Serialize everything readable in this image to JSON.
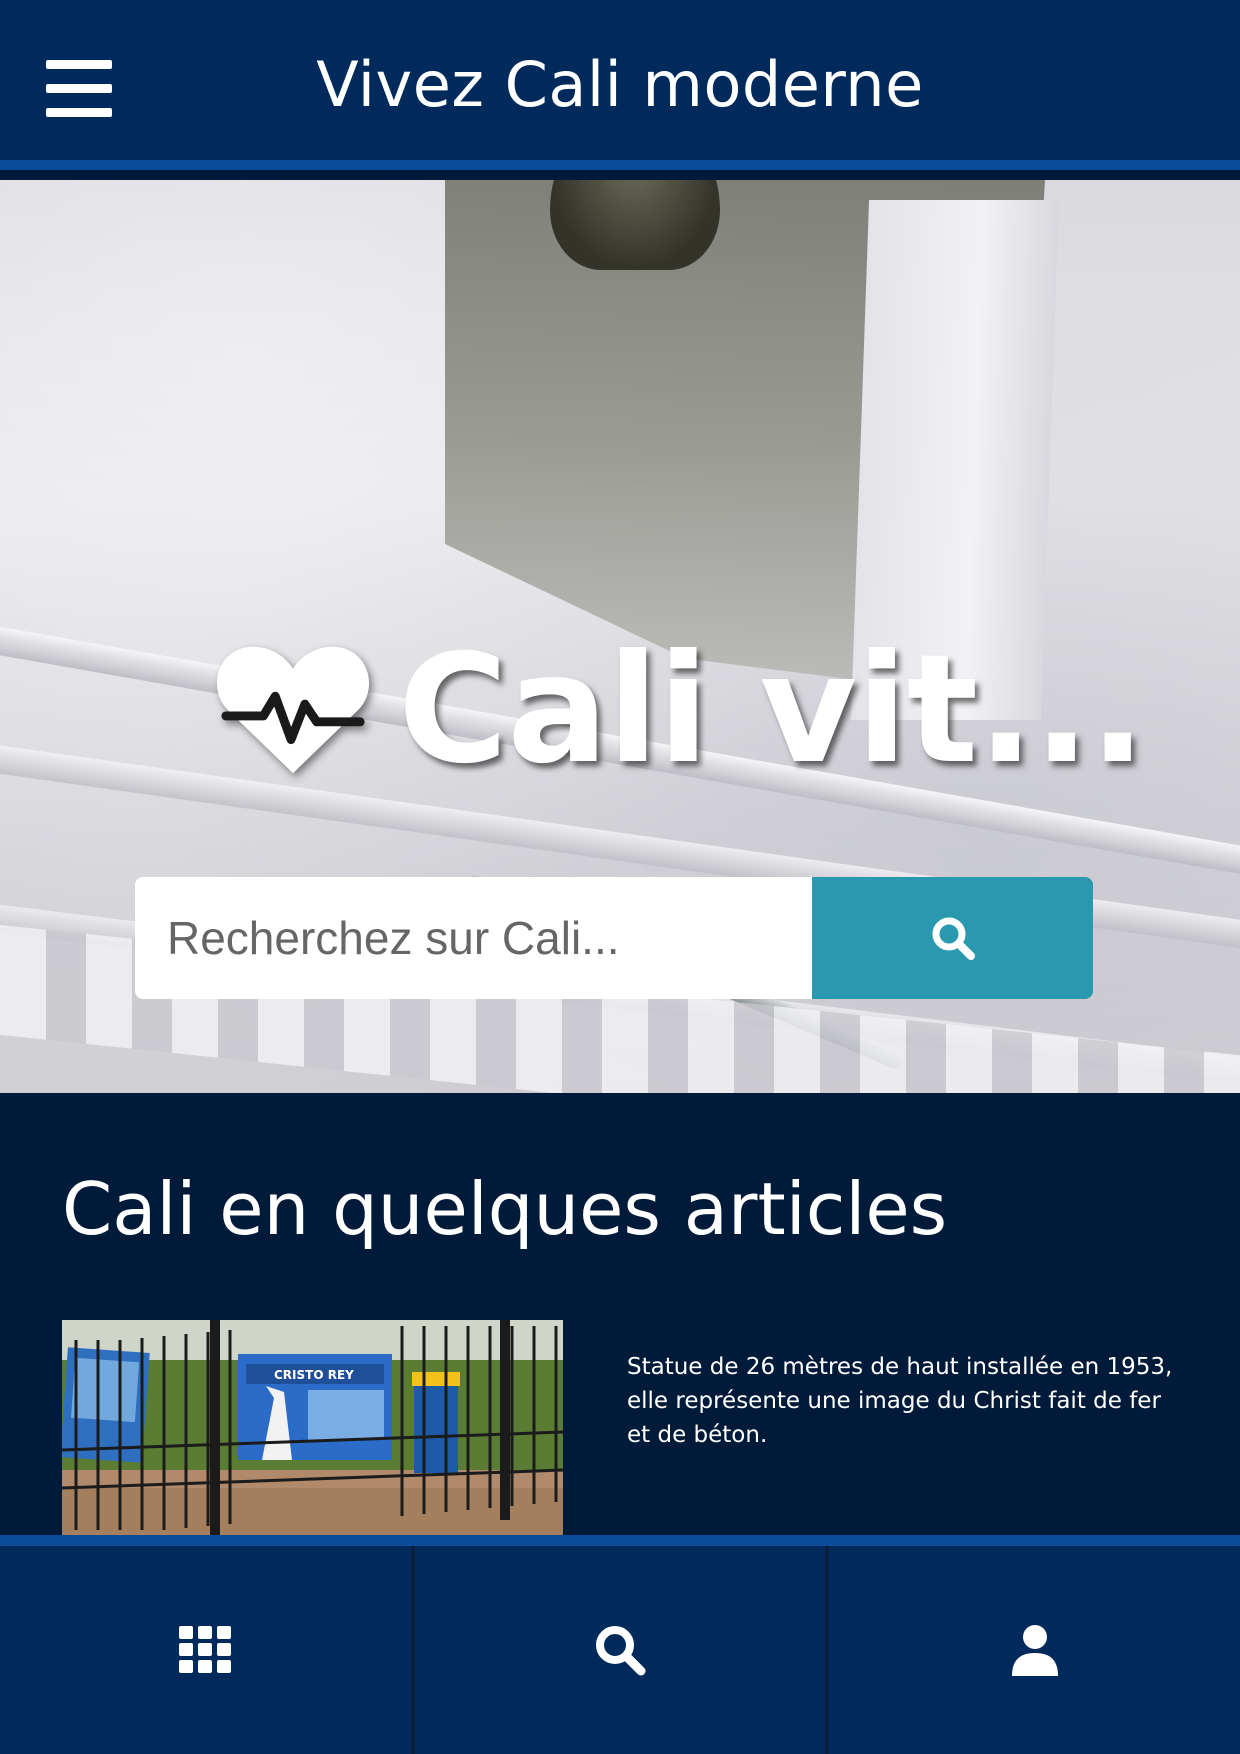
{
  "header": {
    "title": "Vivez Cali moderne",
    "menu_icon": "hamburger-menu-icon"
  },
  "hero": {
    "title": "Cali vit...",
    "icon": "heart-pulse-icon",
    "search": {
      "placeholder": "Recherchez sur Cali...",
      "value": "",
      "button_icon": "search-icon"
    }
  },
  "articles": {
    "title": "Cali en quelques articles",
    "items": [
      {
        "description": "Statue de 26 mètres de haut installée en 1953, elle représente une image du Christ fait de fer et de béton.",
        "thumb_sign_text": "CRISTO REY"
      }
    ]
  },
  "bottom_nav": {
    "items": [
      {
        "icon": "grid-icon"
      },
      {
        "icon": "search-icon"
      },
      {
        "icon": "user-icon"
      }
    ]
  },
  "colors": {
    "header_bg": "#002a5c",
    "accent_bar": "#0b4c99",
    "section_bg": "#001a3a",
    "search_button": "#2a99b0"
  }
}
